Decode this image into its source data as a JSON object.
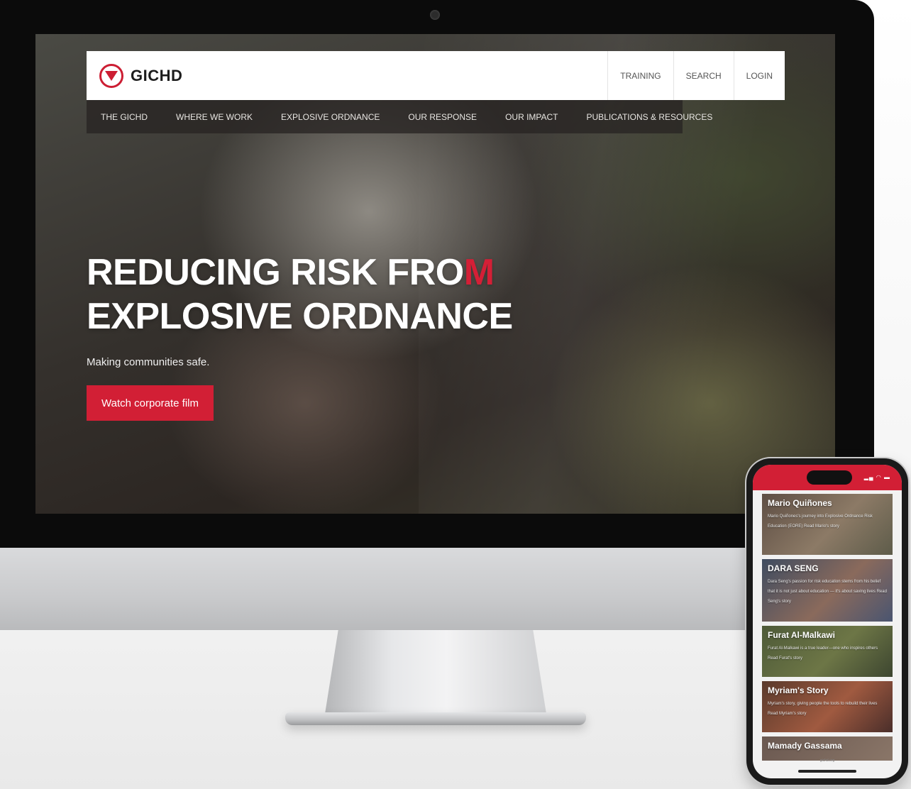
{
  "site": {
    "logo_text": "GICHD",
    "utility_nav": [
      "TRAINING",
      "SEARCH",
      "LOGIN"
    ],
    "main_nav": [
      "THE GICHD",
      "WHERE WE WORK",
      "EXPLOSIVE ORDNANCE",
      "OUR RESPONSE",
      "OUR IMPACT",
      "PUBLICATIONS & RESOURCES"
    ]
  },
  "hero": {
    "title_line1_main": "REDUCING RISK FRO",
    "title_line1_accent": "M",
    "title_line2": "EXPLOSIVE ORDNANCE",
    "subtitle": "Making communities safe.",
    "cta_label": "Watch corporate film"
  },
  "phone": {
    "stories": [
      {
        "title": "Mario Quiñones",
        "text": "Mario Quiñones's journey into Explosive Ordnance Risk Education (EORE) Read Mario's story"
      },
      {
        "title": "DARA SENG",
        "text": "Dara Seng's passion for risk education stems from his belief that it is not just about education — it's about saving lives Read Seng's story"
      },
      {
        "title": "Furat Al-Malkawi",
        "text": "Furat Al-Malkawi is a true leader—one who inspires others Read Furat's story"
      },
      {
        "title": "Myriam's Story",
        "text": "Myriam's story, giving people the tools to rebuild their lives Read Myriam's story"
      },
      {
        "title": "Mamady Gassama",
        "text": ""
      }
    ],
    "url": "gichd.org"
  },
  "colors": {
    "brand_red": "#d21f35",
    "nav_bg": "#2a2522",
    "header_bg": "#ffffff"
  },
  "icons": [
    "gichd-logo-icon",
    "camera-icon",
    "signal-wifi-battery-icon"
  ]
}
